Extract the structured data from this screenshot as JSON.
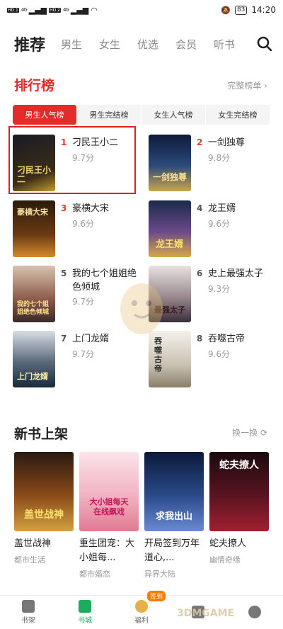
{
  "status_bar": {
    "battery": "83",
    "time": "14:20",
    "hd1": "HD 1",
    "hd2": "HD 2",
    "net1": "4G",
    "net2": "4G"
  },
  "top_tabs": {
    "active": "推荐",
    "items": [
      "男生",
      "女生",
      "优选",
      "会员",
      "听书"
    ]
  },
  "ranking": {
    "title": "排行榜",
    "more": "完整榜单",
    "tabs": [
      "男生人气榜",
      "男生完结榜",
      "女生人气榜",
      "女生完结榜"
    ],
    "items": [
      {
        "rank": "1",
        "name": "刁民王小二",
        "score": "9.7分",
        "cover_text": "刁民王小二"
      },
      {
        "rank": "2",
        "name": "一剑独尊",
        "score": "9.8分",
        "cover_text": "一剑独尊"
      },
      {
        "rank": "3",
        "name": "豪横大宋",
        "score": "9.6分",
        "cover_text": "豪横大宋"
      },
      {
        "rank": "4",
        "name": "龙王婿",
        "score": "9.6分",
        "cover_text": "龙王婿"
      },
      {
        "rank": "5",
        "name": "我的七个姐姐绝色倾城",
        "score": "9.7分",
        "cover_text": "我的七个姐姐绝色倾城"
      },
      {
        "rank": "6",
        "name": "史上最强太子",
        "score": "9.3分",
        "cover_text": "最强太子"
      },
      {
        "rank": "7",
        "name": "上门龙婿",
        "score": "9.7分",
        "cover_text": "上门龙婿"
      },
      {
        "rank": "8",
        "name": "吞噬古帝",
        "score": "9.6分",
        "cover_text": "吞噬古帝"
      }
    ]
  },
  "new_books": {
    "title": "新书上架",
    "more": "换一换",
    "items": [
      {
        "name": "盖世战神",
        "category": "都市生活",
        "cover_text": "盖世战神"
      },
      {
        "name": "重生团宠：大小姐每...",
        "category": "都市婚恋",
        "cover_text": "大小姐每天在线飙戏"
      },
      {
        "name": "开局签到万年道心,...",
        "category": "异界大陆",
        "cover_text": "求我出山"
      },
      {
        "name": "蛇夫撩人",
        "category": "幽情奇缘",
        "cover_text": "蛇夫撩人"
      }
    ]
  },
  "bottom_nav": {
    "items": [
      "书架",
      "书城",
      "福利",
      "",
      ""
    ],
    "badge": "签到",
    "watermark": "3DMGAME"
  },
  "colors": {
    "accent_red": "#e52a2a",
    "active_green": "#1aad5b"
  }
}
